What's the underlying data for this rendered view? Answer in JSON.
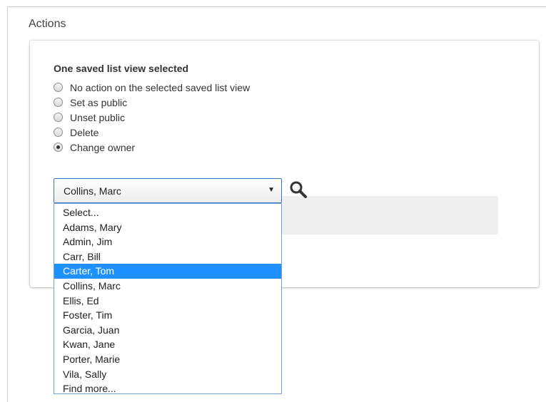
{
  "section": {
    "title": "Actions"
  },
  "card": {
    "heading": "One saved list view selected",
    "radio_options": [
      {
        "label": "No action on the selected saved list view",
        "checked": false
      },
      {
        "label": "Set as public",
        "checked": false
      },
      {
        "label": "Unset public",
        "checked": false
      },
      {
        "label": "Delete",
        "checked": false
      },
      {
        "label": "Change owner",
        "checked": true
      }
    ]
  },
  "owner_select": {
    "value": "Collins, Marc",
    "arrow_icon": "caret-down-icon",
    "search_icon": "magnifier-icon",
    "options": [
      "Select...",
      "Adams, Mary",
      "Admin, Jim",
      "Carr, Bill",
      "Carter, Tom",
      "Collins, Marc",
      "Ellis, Ed",
      "Foster, Tim",
      "Garcia, Juan",
      "Kwan, Jane",
      "Porter, Marie",
      "Vila, Sally",
      "Find more..."
    ],
    "highlighted_option": "Carter, Tom"
  },
  "colors": {
    "highlight": "#1e90ff",
    "select_border": "#3b78c3",
    "panel_gray": "#efefef"
  }
}
